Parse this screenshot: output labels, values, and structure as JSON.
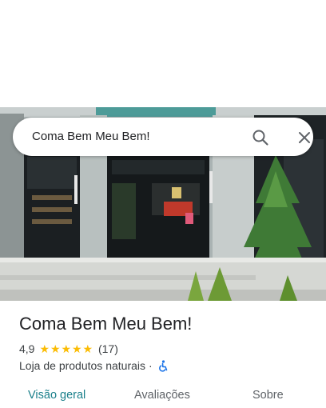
{
  "search": {
    "query": "Coma Bem Meu Bem!"
  },
  "place": {
    "name": "Coma Bem Meu Bem!",
    "rating": "4,9",
    "stars": 5,
    "review_count": "(17)",
    "category": "Loja de produtos naturais",
    "separator": "·"
  },
  "tabs": [
    {
      "label": "Visão geral",
      "active": true
    },
    {
      "label": "Avaliações",
      "active": false
    },
    {
      "label": "Sobre",
      "active": false
    }
  ],
  "colors": {
    "accent": "#1a7f8a",
    "star": "#fbbc04",
    "accessibility": "#1a73e8"
  },
  "icons": {
    "search": "search-icon",
    "close": "close-icon",
    "accessibility": "wheelchair-icon"
  }
}
